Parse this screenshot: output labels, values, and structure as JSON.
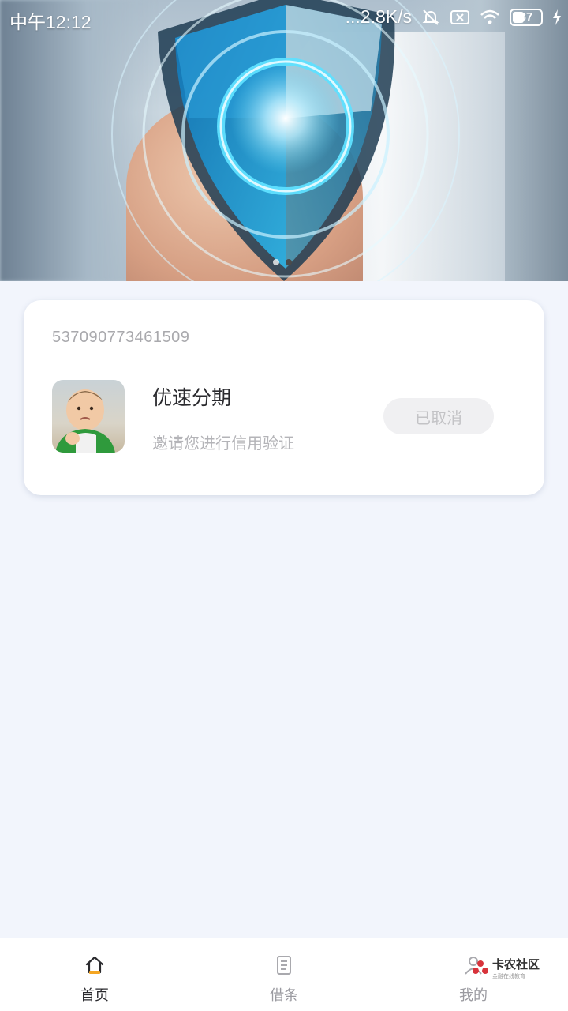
{
  "status_bar": {
    "time": "中午12:12",
    "network_speed": "...2.8K/s",
    "battery_level": "37"
  },
  "banner": {
    "pages_total": 2,
    "active_page_index": 1,
    "shield_colors": [
      "#1a9ad6",
      "#5fd0f0",
      "#ffffff"
    ]
  },
  "card": {
    "order_number": "537090773461509",
    "product_name": "优速分期",
    "product_subtitle": "邀请您进行信用验证",
    "status_button_label": "已取消"
  },
  "bottom_nav": {
    "items": [
      {
        "label": "首页",
        "icon": "home-icon",
        "active": true
      },
      {
        "label": "借条",
        "icon": "document-icon",
        "active": false
      },
      {
        "label": "我的",
        "icon": "person-icon",
        "active": false
      }
    ]
  },
  "watermark": {
    "main": "卡农社区",
    "sub": "金融在线教育"
  },
  "colors": {
    "accent": "#f5a623",
    "page_background": "#f2f5fc",
    "text_primary": "#2a2a2e",
    "text_muted": "#b4b4b8"
  }
}
